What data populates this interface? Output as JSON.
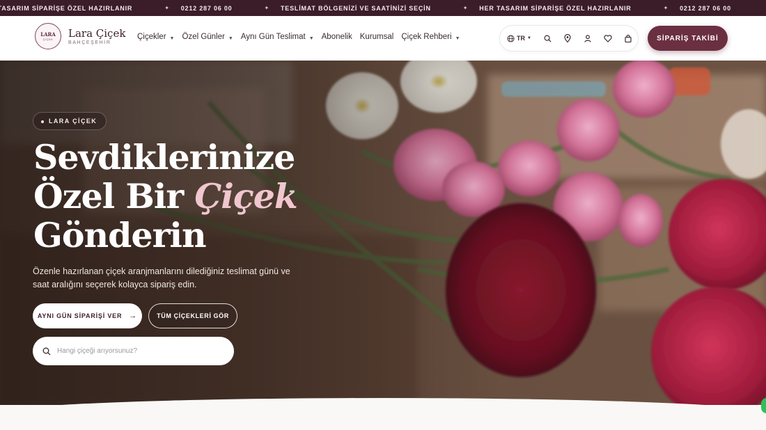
{
  "ticker": {
    "items": [
      "R TASARIM SİPARİŞE ÖZEL HAZIRLANIR",
      "0212 287 06 00",
      "TESLİMAT BÖLGENİZİ VE SAATİNİZİ SEÇİN",
      "HER TASARIM SİPARİŞE ÖZEL HAZIRLANIR",
      "0212 287 06 00"
    ]
  },
  "logo": {
    "badge_top": "LARA",
    "badge_bottom": "ÇİÇEK",
    "name": "Lara Çiçek",
    "sub": "BAHÇEŞEHİR"
  },
  "nav": {
    "items": [
      {
        "label": "Çiçekler",
        "has_dropdown": true
      },
      {
        "label": "Özel Günler",
        "has_dropdown": true
      },
      {
        "label": "Aynı Gün Teslimat",
        "has_dropdown": true
      },
      {
        "label": "Abonelik",
        "has_dropdown": false
      },
      {
        "label": "Kurumsal",
        "has_dropdown": false
      },
      {
        "label": "Çiçek Rehberi",
        "has_dropdown": true
      }
    ]
  },
  "toolbar": {
    "lang": "TR",
    "icons": [
      "globe-icon",
      "search-icon",
      "location-pin-icon",
      "user-icon",
      "heart-icon",
      "shopping-bag-icon"
    ]
  },
  "order_tracking_label": "SİPARİŞ TAKİBİ",
  "hero": {
    "tag": "LARA ÇİÇEK",
    "title_line1": "Sevdiklerinize",
    "title_line2_prefix": "Özel Bir ",
    "title_line2_script": "Çiçek",
    "title_line3": "Gönderin",
    "description": "Özenle hazırlanan çiçek aranjmanlarını dilediğiniz teslimat günü ve saat aralığını seçerek kolayca sipariş edin.",
    "primary_button": "AYNI GÜN SİPARİŞİ VER",
    "secondary_button": "TÜM ÇİÇEKLERİ GÖR",
    "search_placeholder": "Hangi çiçeği arıyorsunuz?"
  },
  "colors": {
    "brand": "#6b2f42",
    "ticker_bg": "#3b1d29",
    "accent_script": "#f0c6cf",
    "whatsapp": "#2fbf5a"
  }
}
